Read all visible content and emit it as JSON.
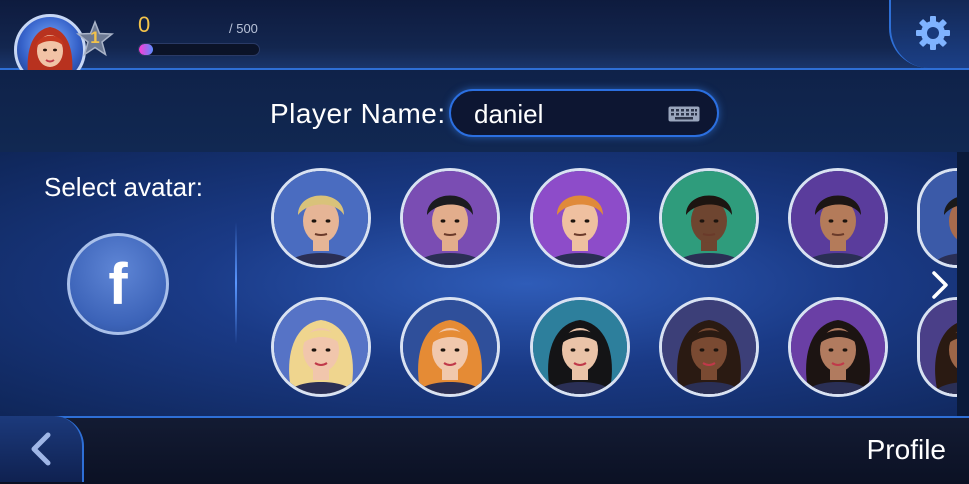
{
  "player": {
    "username": "daniel",
    "level": "1",
    "xp_current": "0",
    "xp_max": "/ 500",
    "xp_progress": 0.12
  },
  "name_form": {
    "label": "Player Name:",
    "value": "daniel"
  },
  "avatars": {
    "label": "Select avatar:",
    "facebook_glyph": "f",
    "row1": [
      {
        "name": "blond-man",
        "hair": "#d9c27a",
        "skin": "#e6b596",
        "bg": "#4a6cc0"
      },
      {
        "name": "dark-haired-man",
        "hair": "#1b1b1f",
        "skin": "#e2ad8c",
        "bg": "#7a4db3"
      },
      {
        "name": "ginger-man",
        "hair": "#e08a3a",
        "skin": "#efc0a0",
        "bg": "#8d4cc9"
      },
      {
        "name": "bearded-man",
        "hair": "#1c1410",
        "skin": "#6e4530",
        "bg": "#2f9c7c"
      },
      {
        "name": "tan-man",
        "hair": "#1c1614",
        "skin": "#b47b5a",
        "bg": "#5a3c9c"
      },
      {
        "name": "partial-man",
        "hair": "#1a1a1a",
        "skin": "#a86b4d",
        "bg": "#3b5aa8"
      }
    ],
    "row2": [
      {
        "name": "blonde-woman",
        "hair": "#efd58e",
        "skin": "#f1c6ac",
        "bg": "#5673c6"
      },
      {
        "name": "redhead-woman",
        "hair": "#e58b35",
        "skin": "#f1c8ad",
        "bg": "#2f4f9a"
      },
      {
        "name": "black-bob-woman",
        "hair": "#141416",
        "skin": "#eac3a8",
        "bg": "#2d7f9c"
      },
      {
        "name": "curly-woman",
        "hair": "#2a1a12",
        "skin": "#7a4a32",
        "bg": "#3c3f78"
      },
      {
        "name": "brunette-woman",
        "hair": "#1c1412",
        "skin": "#b17b5f",
        "bg": "#6a3fa5"
      },
      {
        "name": "partial-woman",
        "hair": "#2a1a12",
        "skin": "#9c6648",
        "bg": "#4a3f88"
      }
    ]
  },
  "navigation": {
    "screen_title": "Profile"
  },
  "colors": {
    "accent": "#2e6fd6",
    "gold": "#f3c34a"
  }
}
